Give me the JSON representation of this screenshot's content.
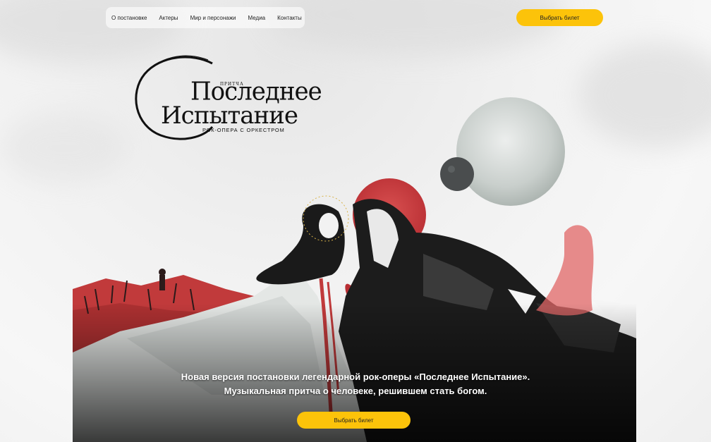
{
  "nav": {
    "items": [
      "О постановке",
      "Актеры",
      "Мир и персонажи",
      "Медиа",
      "Контакты"
    ]
  },
  "header": {
    "ticket_button": "Выбрать билет"
  },
  "logo": {
    "small": "ПРИТЧА",
    "line1": "Последнее",
    "line2": "Испытание",
    "subtitle": "РОК-ОПЕРА С ОРКЕСТРОМ"
  },
  "hero": {
    "line1": "Новая версия постановки легендарной рок-оперы «Последнее Испытание».",
    "line2": "Музыкальная притча о человеке, решившем стать богом.",
    "ticket_button": "Выбрать билет"
  },
  "colors": {
    "accent": "#fcc30a",
    "blood": "#c8393a",
    "ink": "#111111"
  }
}
